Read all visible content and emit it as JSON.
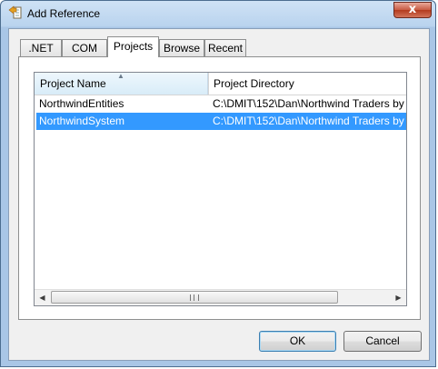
{
  "window": {
    "title": "Add Reference",
    "close_glyph": "x",
    "app_icon": "add-reference-icon"
  },
  "tabs": [
    {
      "label": ".NET",
      "active": false
    },
    {
      "label": "COM",
      "active": false
    },
    {
      "label": "Projects",
      "active": true
    },
    {
      "label": "Browse",
      "active": false
    },
    {
      "label": "Recent",
      "active": false
    }
  ],
  "list": {
    "columns": [
      {
        "label": "Project Name",
        "sorted": "ascending"
      },
      {
        "label": "Project Directory"
      }
    ],
    "rows": [
      {
        "name": "NorthwindEntities",
        "directory": "C:\\DMIT\\152\\Dan\\Northwind Traders by",
        "selected": false
      },
      {
        "name": "NorthwindSystem",
        "directory": "C:\\DMIT\\152\\Dan\\Northwind Traders by",
        "selected": true
      }
    ],
    "scroll_left_glyph": "◀",
    "scroll_right_glyph": "▶"
  },
  "buttons": {
    "ok": "OK",
    "cancel": "Cancel"
  },
  "colors": {
    "selection": "#3399ff",
    "title_bar": "#b9d3ee",
    "close_button": "#c75a41"
  }
}
